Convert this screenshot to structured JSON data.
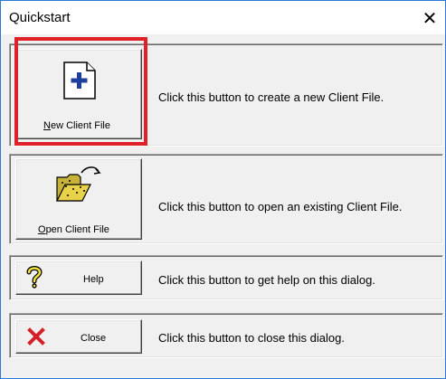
{
  "window": {
    "title": "Quickstart",
    "close_glyph": "✕"
  },
  "rows": [
    {
      "button_prefix": "N",
      "button_rest": "ew Client File",
      "description": "Click this button to create a new Client File.",
      "icon": "new-document-icon"
    },
    {
      "button_prefix": "O",
      "button_rest": "pen Client File",
      "description": "Click this button to open an existing Client File.",
      "icon": "open-folder-icon"
    },
    {
      "button_label": "Help",
      "description": "Click this button to get help on this dialog.",
      "icon": "question-mark-icon"
    },
    {
      "button_label": "Close",
      "description": "Click this button to close this dialog.",
      "icon": "red-x-icon"
    }
  ],
  "colors": {
    "highlight": "#e02027",
    "plus": "#1f3f9f",
    "folder": "#e8d24a",
    "x_icon": "#d31f26"
  }
}
